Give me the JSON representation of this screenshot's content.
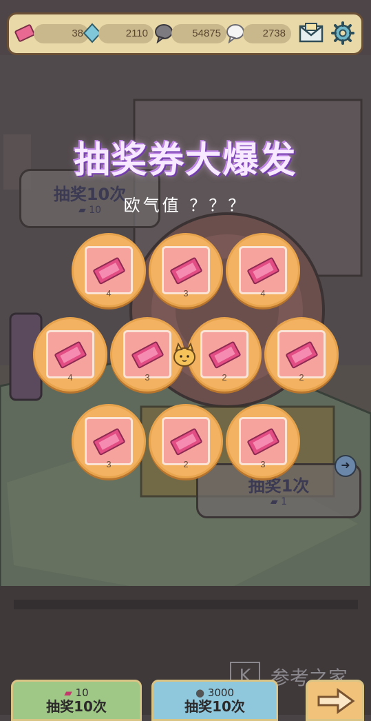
{
  "currency": {
    "tickets": "38",
    "gems": "2110",
    "grey_bubbles": "54875",
    "white_bubbles": "2738"
  },
  "icons": {
    "ticket": "ticket-icon",
    "gem": "gem-icon",
    "grey_bubble": "grey-speech-bubble-icon",
    "white_bubble": "white-speech-bubble-icon",
    "mail": "mail-icon",
    "settings": "gear-icon"
  },
  "headline": "抽奖券大爆发",
  "luck_text": "欧气值 ？？？",
  "background_panels": {
    "draw10_label": "抽奖10次",
    "draw10_cost": "10",
    "draw1_label": "抽奖1次",
    "draw1_cost": "1"
  },
  "ticket_tiles": {
    "row1": [
      "4",
      "3",
      "4"
    ],
    "row2": [
      "4",
      "3",
      "2",
      "2"
    ],
    "row3": [
      "3",
      "2",
      "3"
    ]
  },
  "buttons": {
    "ticket_draw": {
      "cost": "10",
      "label": "抽奖10次",
      "color": "#9fc786"
    },
    "bubble_draw": {
      "cost": "3000",
      "label": "抽奖10次",
      "color": "#8fc7dc"
    }
  },
  "watermark": "参考之家",
  "colors": {
    "tile": "#f2b261",
    "ticket_card": "#f6a39d",
    "ticket": "#e24d83",
    "topbar": "#e9d9a8"
  }
}
